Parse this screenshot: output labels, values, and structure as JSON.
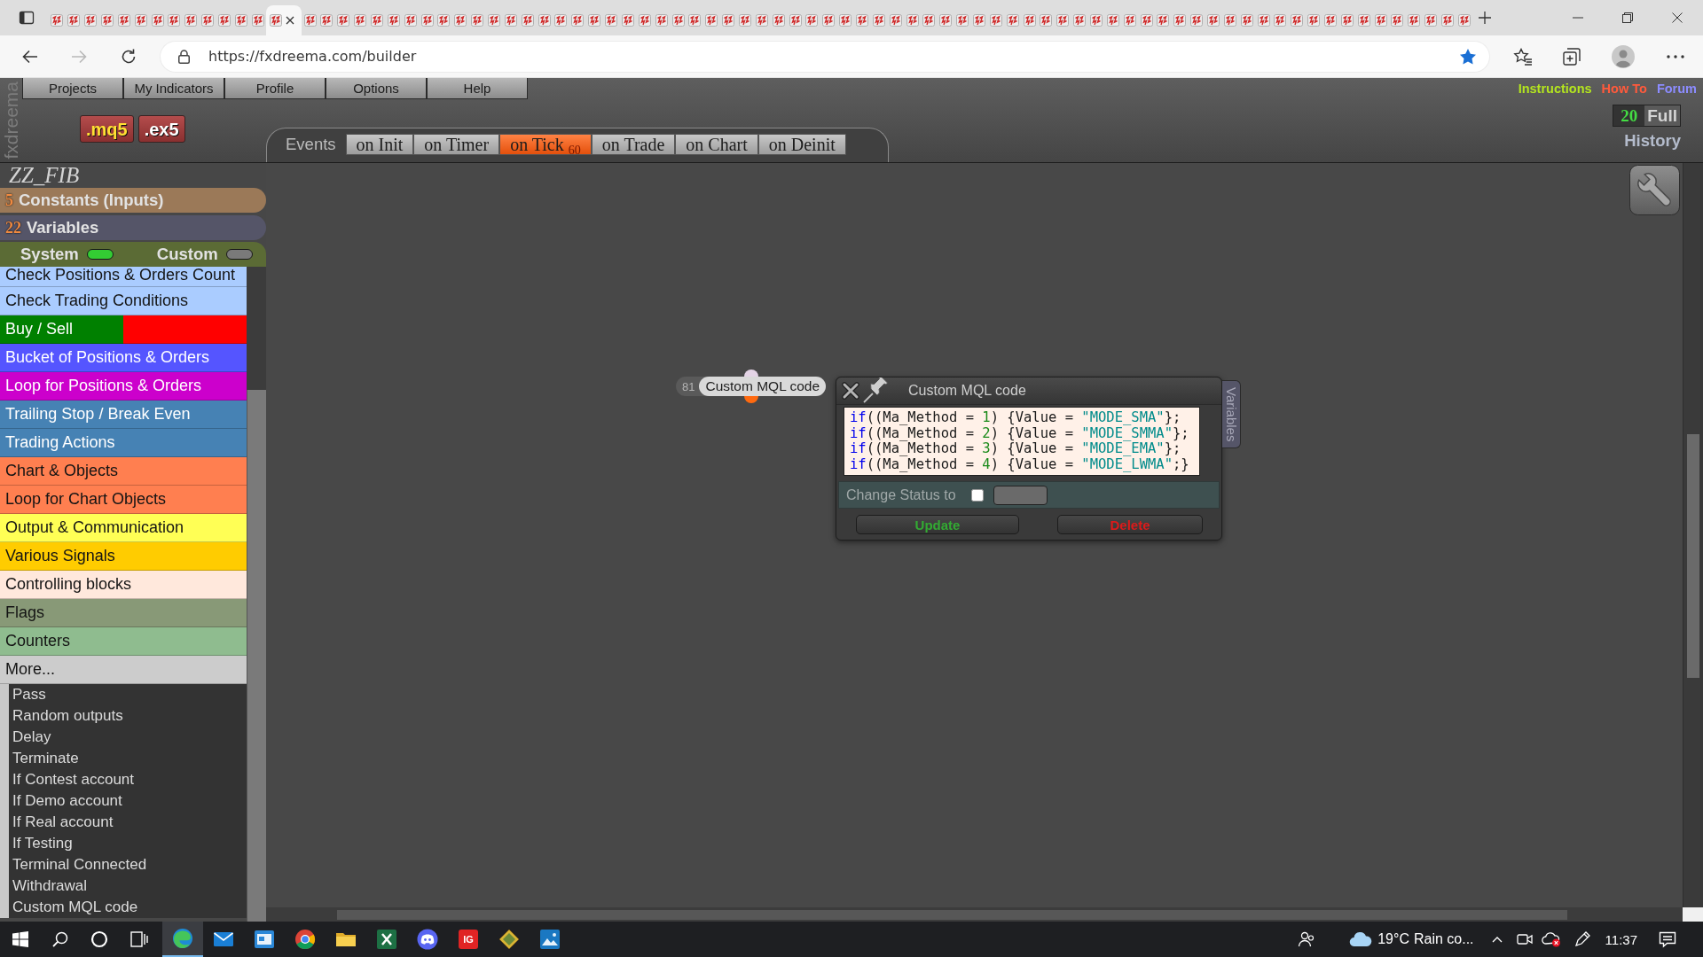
{
  "browser": {
    "tabs": [
      {
        "selected": false
      },
      {
        "selected": false
      },
      {
        "selected": false
      },
      {
        "selected": false
      },
      {
        "selected": false
      },
      {
        "selected": false
      },
      {
        "selected": false
      },
      {
        "selected": false
      },
      {
        "selected": false
      },
      {
        "selected": false
      },
      {
        "selected": false
      },
      {
        "selected": false
      },
      {
        "selected": false
      },
      {
        "selected": true
      },
      {
        "selected": false
      },
      {
        "selected": false
      },
      {
        "selected": false
      },
      {
        "selected": false
      },
      {
        "selected": false
      },
      {
        "selected": false
      },
      {
        "selected": false
      },
      {
        "selected": false
      },
      {
        "selected": false
      },
      {
        "selected": false
      },
      {
        "selected": false
      },
      {
        "selected": false
      },
      {
        "selected": false
      },
      {
        "selected": false
      },
      {
        "selected": false
      },
      {
        "selected": false
      },
      {
        "selected": false
      },
      {
        "selected": false
      },
      {
        "selected": false
      },
      {
        "selected": false
      },
      {
        "selected": false
      },
      {
        "selected": false
      },
      {
        "selected": false
      },
      {
        "selected": false
      },
      {
        "selected": false
      },
      {
        "selected": false
      },
      {
        "selected": false
      },
      {
        "selected": false
      },
      {
        "selected": false
      },
      {
        "selected": false
      },
      {
        "selected": false
      },
      {
        "selected": false
      },
      {
        "selected": false
      },
      {
        "selected": false
      },
      {
        "selected": false
      },
      {
        "selected": false
      },
      {
        "selected": false
      },
      {
        "selected": false
      },
      {
        "selected": false
      },
      {
        "selected": false
      },
      {
        "selected": false
      },
      {
        "selected": false
      },
      {
        "selected": false
      },
      {
        "selected": false
      },
      {
        "selected": false
      },
      {
        "selected": false
      },
      {
        "selected": false
      },
      {
        "selected": false
      },
      {
        "selected": false
      },
      {
        "selected": false
      },
      {
        "selected": false
      },
      {
        "selected": false
      },
      {
        "selected": false
      },
      {
        "selected": false
      },
      {
        "selected": false
      },
      {
        "selected": false
      },
      {
        "selected": false
      },
      {
        "selected": false
      },
      {
        "selected": false
      },
      {
        "selected": false
      },
      {
        "selected": false
      },
      {
        "selected": false
      },
      {
        "selected": false
      },
      {
        "selected": false
      },
      {
        "selected": false
      },
      {
        "selected": false
      },
      {
        "selected": false
      },
      {
        "selected": false
      },
      {
        "selected": false
      },
      {
        "selected": false
      }
    ],
    "can_go_forward": false,
    "url": "https://fxdreema.com/builder",
    "favorite": true
  },
  "header": {
    "brand": "fxdreema",
    "menu": [
      "Projects",
      "My Indicators",
      "Profile",
      "Options",
      "Help"
    ],
    "export_buttons": [
      {
        "label": ".mq5",
        "color": "#ffe033"
      },
      {
        "label": ".ex5",
        "color": "#ffffff"
      }
    ],
    "links": [
      {
        "label": "Instructions",
        "color": "#b4e61e"
      },
      {
        "label": "How To",
        "color": "#ff5a3c"
      },
      {
        "label": "Forum",
        "color": "#8c8cff"
      }
    ],
    "history": {
      "count": "20",
      "mode": "Full",
      "title": "History"
    }
  },
  "events": {
    "label": "Events",
    "tabs": [
      {
        "label": "on Init",
        "selected": false
      },
      {
        "label": "on Timer",
        "selected": false
      },
      {
        "label": "on Tick $_{60}$",
        "selected": true
      },
      {
        "label": "on Trade",
        "selected": false
      },
      {
        "label": "on Chart",
        "selected": false
      },
      {
        "label": "on Deinit",
        "selected": false
      }
    ]
  },
  "sidebar": {
    "project": "ZZ_FIB",
    "sections": [
      {
        "count": "5",
        "label": "Constants (Inputs)",
        "color": "#9b7958"
      },
      {
        "count": "22",
        "label": "Variables",
        "color": "#555568"
      }
    ],
    "toggles": [
      {
        "label": "System",
        "on": true
      },
      {
        "label": "Custom",
        "on": false
      }
    ],
    "categories": [
      {
        "label": "Check Positions & Orders Count",
        "color": "#aaccff"
      },
      {
        "label": "Check Trading Conditions",
        "color": "#aaccff"
      },
      {
        "label": "Buy / Sell",
        "segments": [
          {
            "color": "#008000"
          },
          {
            "color": "#ff0000"
          }
        ]
      },
      {
        "label": "Bucket of Positions & Orders",
        "color": "#5555ff"
      },
      {
        "label": "Loop for Positions & Orders",
        "color": "#cc00cc"
      },
      {
        "label": "Trailing Stop / Break Even",
        "color": "#4682b4"
      },
      {
        "label": "Trading Actions",
        "color": "#4682b4"
      },
      {
        "label": "Chart & Objects",
        "color": "#ff7f50"
      },
      {
        "label": "Loop for Chart Objects",
        "color": "#ff7f50"
      },
      {
        "label": "Output & Communication",
        "color": "#ffff55"
      },
      {
        "label": "Various Signals",
        "color": "#ffcc00"
      },
      {
        "label": "Controlling blocks",
        "color": "#ffe8dc"
      },
      {
        "label": "Flags",
        "color": "#889977"
      },
      {
        "label": "Counters",
        "color": "#8fbc8f"
      },
      {
        "label": "More...",
        "color": "#cccccc",
        "children": [
          "Pass",
          "Random outputs",
          "Delay",
          "Terminate",
          "If Contest account",
          "If Demo account",
          "If Real account",
          "If Testing",
          "Terminal Connected",
          "Withdrawal",
          "Custom MQL code"
        ]
      }
    ]
  },
  "canvas": {
    "node": {
      "number": "81",
      "label": "Custom MQL code"
    },
    "dialog": {
      "title": "Custom MQL code",
      "code": [
        [
          {
            "kind": "keyword",
            "text": "if"
          },
          {
            "kind": "plain",
            "text": "((Ma_Method = "
          },
          {
            "kind": "number",
            "text": "1"
          },
          {
            "kind": "plain",
            "text": ") {Value = "
          },
          {
            "kind": "string",
            "text": "\"MODE_SMA\""
          },
          {
            "kind": "plain",
            "text": "};"
          }
        ],
        [
          {
            "kind": "keyword",
            "text": "if"
          },
          {
            "kind": "plain",
            "text": "((Ma_Method = "
          },
          {
            "kind": "number",
            "text": "2"
          },
          {
            "kind": "plain",
            "text": ") {Value = "
          },
          {
            "kind": "string",
            "text": "\"MODE_SMMA\""
          },
          {
            "kind": "plain",
            "text": "};"
          }
        ],
        [
          {
            "kind": "keyword",
            "text": "if"
          },
          {
            "kind": "plain",
            "text": "((Ma_Method = "
          },
          {
            "kind": "number",
            "text": "3"
          },
          {
            "kind": "plain",
            "text": ") {Value = "
          },
          {
            "kind": "string",
            "text": "\"MODE_EMA\""
          },
          {
            "kind": "plain",
            "text": "};"
          }
        ],
        [
          {
            "kind": "keyword",
            "text": "if"
          },
          {
            "kind": "plain",
            "text": "((Ma_Method = "
          },
          {
            "kind": "number",
            "text": "4"
          },
          {
            "kind": "plain",
            "text": ") {Value = "
          },
          {
            "kind": "string",
            "text": "\"MODE_LWMA\""
          },
          {
            "kind": "plain",
            "text": ";}"
          }
        ]
      ],
      "status_label": "Change Status to",
      "status_checked": false,
      "buttons": [
        {
          "kind": "update",
          "label": "Update",
          "color": "#33aa33"
        },
        {
          "kind": "delete",
          "label": "Delete",
          "color": "#dd1a1a"
        }
      ],
      "side_tab": "Variables"
    }
  },
  "taskbar": {
    "apps": [
      {
        "kind": "edge",
        "selected": true
      },
      {
        "kind": "mail",
        "selected": false
      },
      {
        "kind": "window",
        "selected": false
      },
      {
        "kind": "chrome",
        "selected": false
      },
      {
        "kind": "folder",
        "selected": false
      },
      {
        "kind": "excel",
        "selected": false
      },
      {
        "kind": "discord",
        "selected": false
      },
      {
        "kind": "ig",
        "label": "IG",
        "selected": false
      },
      {
        "kind": "diamond",
        "selected": false
      },
      {
        "kind": "photos",
        "selected": false
      }
    ],
    "temperature": "19°C",
    "weather": "Rain co...",
    "time": "11:37"
  }
}
